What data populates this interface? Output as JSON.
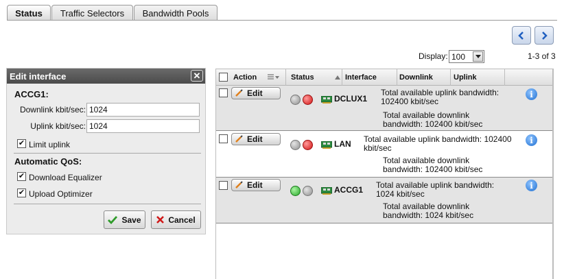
{
  "tabs": [
    {
      "label": "Status",
      "active": true
    },
    {
      "label": "Traffic Selectors",
      "active": false
    },
    {
      "label": "Bandwidth Pools",
      "active": false
    }
  ],
  "pagination": {
    "display_label": "Display:",
    "display_value": "100",
    "count": "1-3 of 3"
  },
  "edit_panel": {
    "title": "Edit interface",
    "close_glyph": "✕",
    "section_interface": "ACCG1:",
    "downlink_label": "Downlink kbit/sec:",
    "downlink_value": "1024",
    "uplink_label": "Uplink kbit/sec:",
    "uplink_value": "1024",
    "limit_uplink_label": "Limit uplink",
    "limit_uplink_checked": true,
    "section_qos": "Automatic QoS:",
    "download_equalizer_label": "Download Equalizer",
    "download_equalizer_checked": true,
    "upload_optimizer_label": "Upload Optimizer",
    "upload_optimizer_checked": true,
    "save_label": "Save",
    "cancel_label": "Cancel"
  },
  "table": {
    "columns": [
      "Action",
      "Status",
      "Interface",
      "Downlink",
      "Uplink"
    ],
    "rows": [
      {
        "edit_label": "Edit",
        "status": [
          "grey",
          "red"
        ],
        "interface": "DCLUX1",
        "uplink_text": "Total available uplink bandwidth: 102400 kbit/sec",
        "downlink_text": "Total available downlink bandwidth: 102400 kbit/sec"
      },
      {
        "edit_label": "Edit",
        "status": [
          "grey",
          "red"
        ],
        "interface": "LAN",
        "uplink_text": "Total available uplink bandwidth: 102400 kbit/sec",
        "downlink_text": "Total available downlink bandwidth: 102400 kbit/sec"
      },
      {
        "edit_label": "Edit",
        "status": [
          "green",
          "grey"
        ],
        "interface": "ACCG1",
        "uplink_text": "Total available uplink bandwidth: 1024 kbit/sec",
        "downlink_text": "Total available downlink bandwidth: 1024 kbit/sec"
      }
    ]
  },
  "icons": {
    "prev": "chevron-left-icon",
    "next": "chevron-right-icon",
    "info": "info-icon",
    "edit": "pencil-icon",
    "save": "checkmark-icon",
    "cancel": "x-icon",
    "network": "network-card-icon"
  },
  "colors": {
    "accent_blue": "#1f6fd1",
    "panel_header": "#555555",
    "status_red": "#d21414",
    "status_green": "#28a82a",
    "row_shade": "#e4e4e4"
  }
}
